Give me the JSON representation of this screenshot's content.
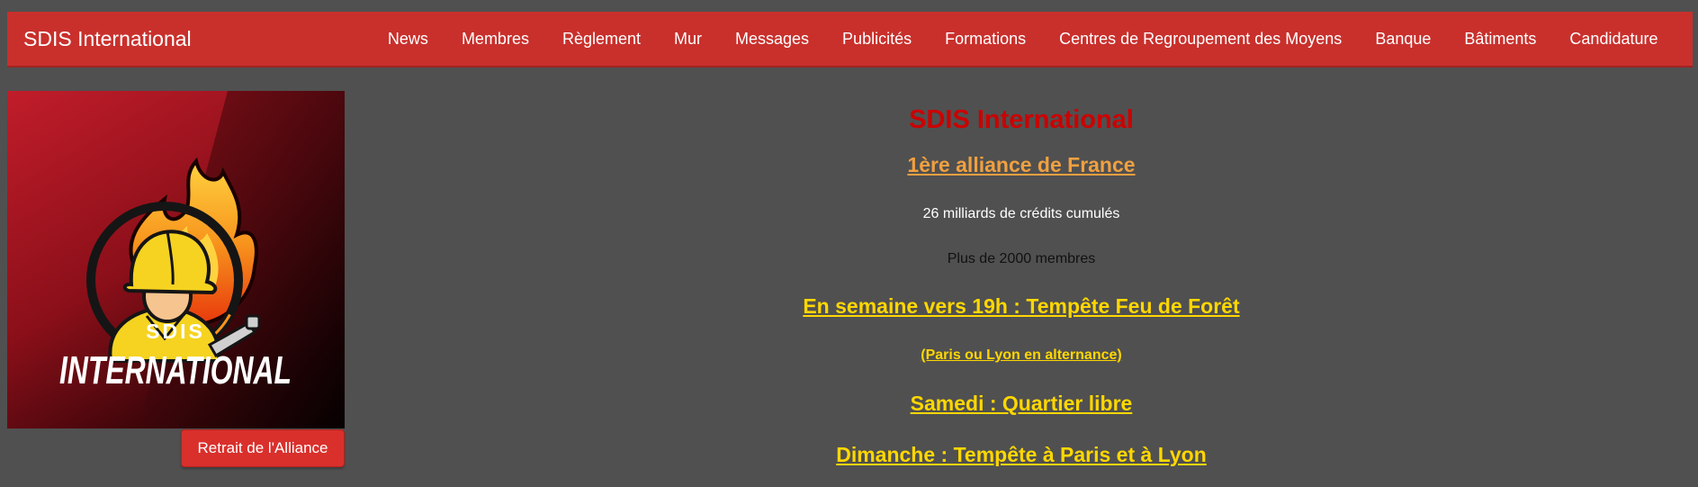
{
  "navbar": {
    "brand": "SDIS International",
    "items": [
      {
        "label": "News"
      },
      {
        "label": "Membres"
      },
      {
        "label": "Règlement"
      },
      {
        "label": "Mur"
      },
      {
        "label": "Messages"
      },
      {
        "label": "Publicités"
      },
      {
        "label": "Formations"
      },
      {
        "label": "Centres de Regroupement des Moyens"
      },
      {
        "label": "Banque"
      },
      {
        "label": "Bâtiments"
      },
      {
        "label": "Candidature"
      }
    ]
  },
  "logo": {
    "line1": "SDIS",
    "line2": "INTERNATIONAL"
  },
  "sidebar": {
    "retreat_label": "Retrait de l'Alliance"
  },
  "main": {
    "title": "SDIS International",
    "subtitle": "1ère alliance de France",
    "credits": "26 milliards de crédits cumulés",
    "members": "Plus de 2000 membres",
    "week": "En semaine vers 19h : Tempête Feu de Forêt",
    "alternance": "(Paris ou Lyon en alternance)",
    "saturday": "Samedi : Quartier libre",
    "sunday": "Dimanche : Tempête à Paris et à Lyon"
  },
  "colors": {
    "background": "#505050",
    "navbar": "#c9302c",
    "title": "#cc0000",
    "subtitle": "#f0a040",
    "highlight": "#ffd700"
  }
}
